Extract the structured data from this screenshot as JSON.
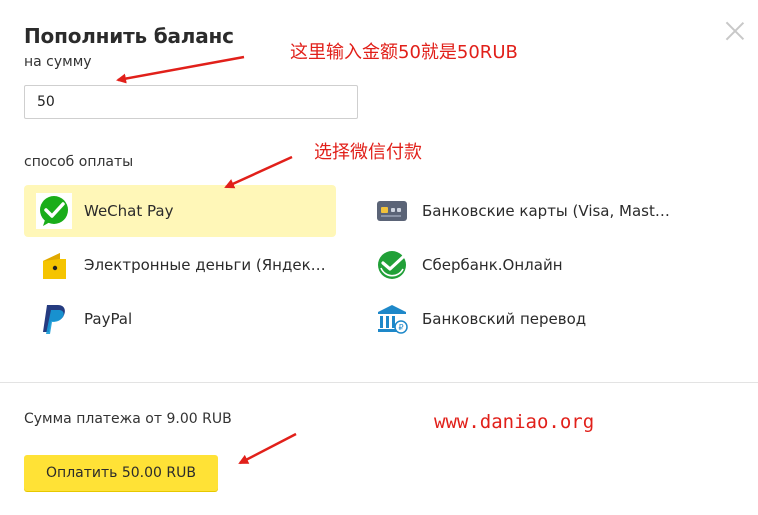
{
  "dialog": {
    "title": "Пополнить баланс",
    "amount_label": "на сумму",
    "amount_value": "50",
    "payment_method_label": "способ оплаты",
    "min_payment_text": "Сумма платежа от 9.00 RUB",
    "pay_button_label": "Оплатить 50.00 RUB"
  },
  "methods": [
    {
      "label": "WeChat Pay",
      "icon": "wechat-pay-icon",
      "selected": true
    },
    {
      "label": "Банковские карты (Visa, Mast…",
      "icon": "bank-card-icon",
      "selected": false
    },
    {
      "label": "Электронные деньги (Яндек…",
      "icon": "yandex-money-icon",
      "selected": false
    },
    {
      "label": "Сбербанк.Онлайн",
      "icon": "sberbank-icon",
      "selected": false
    },
    {
      "label": "PayPal",
      "icon": "paypal-icon",
      "selected": false
    },
    {
      "label": "Банковский перевод",
      "icon": "bank-transfer-icon",
      "selected": false
    }
  ],
  "annotations": {
    "amount_note": "这里输入金额50就是50RUB",
    "wechat_note": "选择微信付款",
    "watermark": "www.daniao.org"
  },
  "colors": {
    "selected_bg": "#fff7b8",
    "pay_button": "#ffe236",
    "annotation_red": "#e1201a",
    "wechat_green": "#1aad19",
    "sber_green": "#21a038",
    "bank_blue": "#1e88c9"
  }
}
